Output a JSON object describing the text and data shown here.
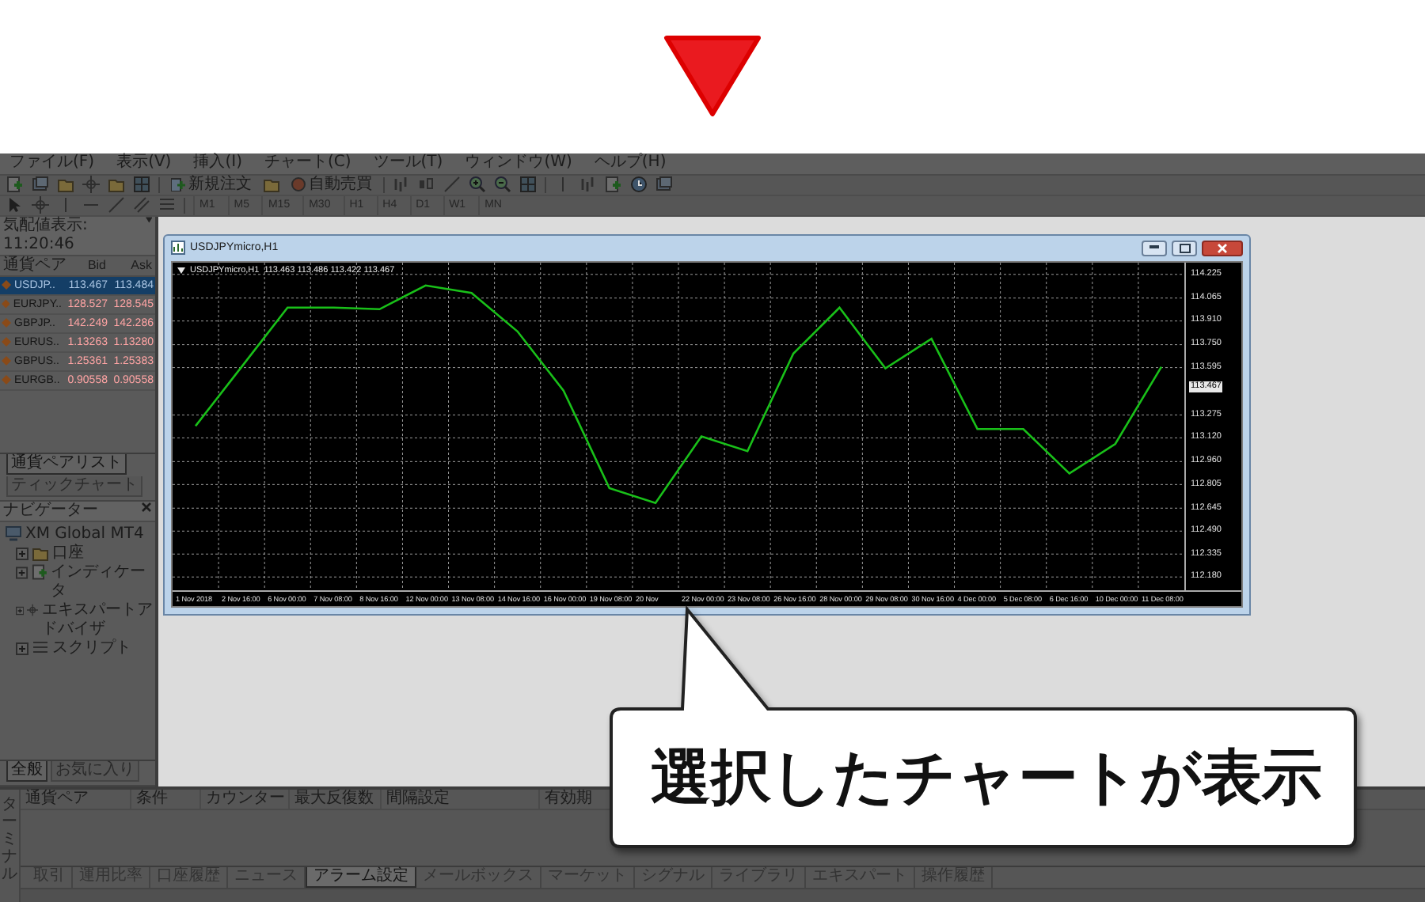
{
  "menu": [
    "ファイル(F)",
    "表示(V)",
    "挿入(I)",
    "チャート(C)",
    "ツール(T)",
    "ウィンドウ(W)",
    "ヘルプ(H)"
  ],
  "toolbar": {
    "order_button": "新規注文",
    "autotrade_button": "自動売買",
    "timeframes": [
      "M1",
      "M5",
      "M15",
      "M30",
      "H1",
      "H4",
      "D1",
      "W1",
      "MN"
    ]
  },
  "market_watch": {
    "title": "気配値表示: 11:20:46",
    "columns": [
      "通貨ペア",
      "Bid",
      "Ask"
    ],
    "rows": [
      {
        "symbol": "USDJP..",
        "bid": "113.467",
        "ask": "113.484",
        "selected": true
      },
      {
        "symbol": "EURJPY..",
        "bid": "128.527",
        "ask": "128.545",
        "selected": false
      },
      {
        "symbol": "GBPJP..",
        "bid": "142.249",
        "ask": "142.286",
        "selected": false
      },
      {
        "symbol": "EURUS..",
        "bid": "1.13263",
        "ask": "1.13280",
        "selected": false
      },
      {
        "symbol": "GBPUS..",
        "bid": "1.25361",
        "ask": "1.25383",
        "selected": false
      },
      {
        "symbol": "EURGB..",
        "bid": "0.90558",
        "ask": "0.90558",
        "selected": false
      }
    ],
    "tabs": [
      {
        "label": "通貨ペアリスト",
        "selected": true
      },
      {
        "label": "ティックチャート",
        "selected": false
      }
    ]
  },
  "navigator": {
    "title": "ナビゲーター",
    "root": {
      "label": "XM Global MT4",
      "children": [
        {
          "label": "口座",
          "expanded": false
        },
        {
          "label": "インディケータ",
          "expanded": false
        },
        {
          "label": "エキスパートアドバイザ",
          "expanded": false
        },
        {
          "label": "スクリプト",
          "expanded": false
        }
      ]
    },
    "tabs": [
      {
        "label": "全般",
        "selected": true
      },
      {
        "label": "お気に入り",
        "selected": false
      }
    ]
  },
  "chart_window": {
    "title": "USDJPYmicro,H1",
    "legend_values": "113.463 113.486 113.422 113.467",
    "current_price": "113.467",
    "chart_data": {
      "type": "line",
      "grid": true,
      "ylim": [
        112.101,
        114.304
      ],
      "categories": [
        "1 Nov 2018",
        "2 Nov 16:00",
        "6 Nov 00:00",
        "7 Nov 08:00",
        "8 Nov 16:00",
        "12 Nov 00:00",
        "13 Nov 08:00",
        "14 Nov 16:00",
        "16 Nov 00:00",
        "19 Nov 08:00",
        "20 Nov",
        "22 Nov 00:00",
        "23 Nov 08:00",
        "26 Nov 16:00",
        "28 Nov 00:00",
        "29 Nov 08:00",
        "30 Nov 16:00",
        "4 Dec 00:00",
        "5 Dec 08:00",
        "6 Dec 16:00",
        "10 Dec 00:00",
        "11 Dec 08:00"
      ],
      "yticks": [
        {
          "value": 114.225,
          "label": "114.225"
        },
        {
          "value": 114.065,
          "label": "114.065"
        },
        {
          "value": 113.91,
          "label": "113.910"
        },
        {
          "value": 113.75,
          "label": "113.750"
        },
        {
          "value": 113.595,
          "label": "113.595"
        },
        {
          "value": 113.275,
          "label": "113.275"
        },
        {
          "value": 113.12,
          "label": "113.120"
        },
        {
          "value": 112.96,
          "label": "112.960"
        },
        {
          "value": 112.805,
          "label": "112.805"
        },
        {
          "value": 112.645,
          "label": "112.645"
        },
        {
          "value": 112.49,
          "label": "112.490"
        },
        {
          "value": 112.335,
          "label": "112.335"
        },
        {
          "value": 112.18,
          "label": "112.180"
        }
      ],
      "series": [
        {
          "name": "USDJPYmicro,H1",
          "color": "#19c019",
          "values": [
            113.2,
            113.6,
            114.0,
            114.0,
            113.99,
            114.15,
            114.1,
            113.84,
            113.44,
            112.78,
            112.68,
            113.13,
            113.03,
            113.69,
            114.0,
            113.59,
            113.79,
            113.18,
            113.18,
            112.88,
            113.08,
            113.6
          ]
        }
      ]
    }
  },
  "terminal": {
    "side_title": "ターミナル",
    "columns": [
      "通貨ペア",
      "条件",
      "カウンター",
      "最大反復数",
      "間隔設定",
      "有効期"
    ],
    "tabs": [
      {
        "label": "取引",
        "selected": false
      },
      {
        "label": "運用比率",
        "selected": false
      },
      {
        "label": "口座履歴",
        "selected": false
      },
      {
        "label": "ニュース",
        "selected": false
      },
      {
        "label": "アラーム設定",
        "selected": true
      },
      {
        "label": "メールボックス",
        "selected": false
      },
      {
        "label": "マーケット",
        "selected": false
      },
      {
        "label": "シグナル",
        "selected": false
      },
      {
        "label": "ライブラリ",
        "selected": false
      },
      {
        "label": "エキスパート",
        "selected": false
      },
      {
        "label": "操作履歴",
        "selected": false
      }
    ]
  },
  "callout": {
    "text": "選択したチャートが表示"
  }
}
